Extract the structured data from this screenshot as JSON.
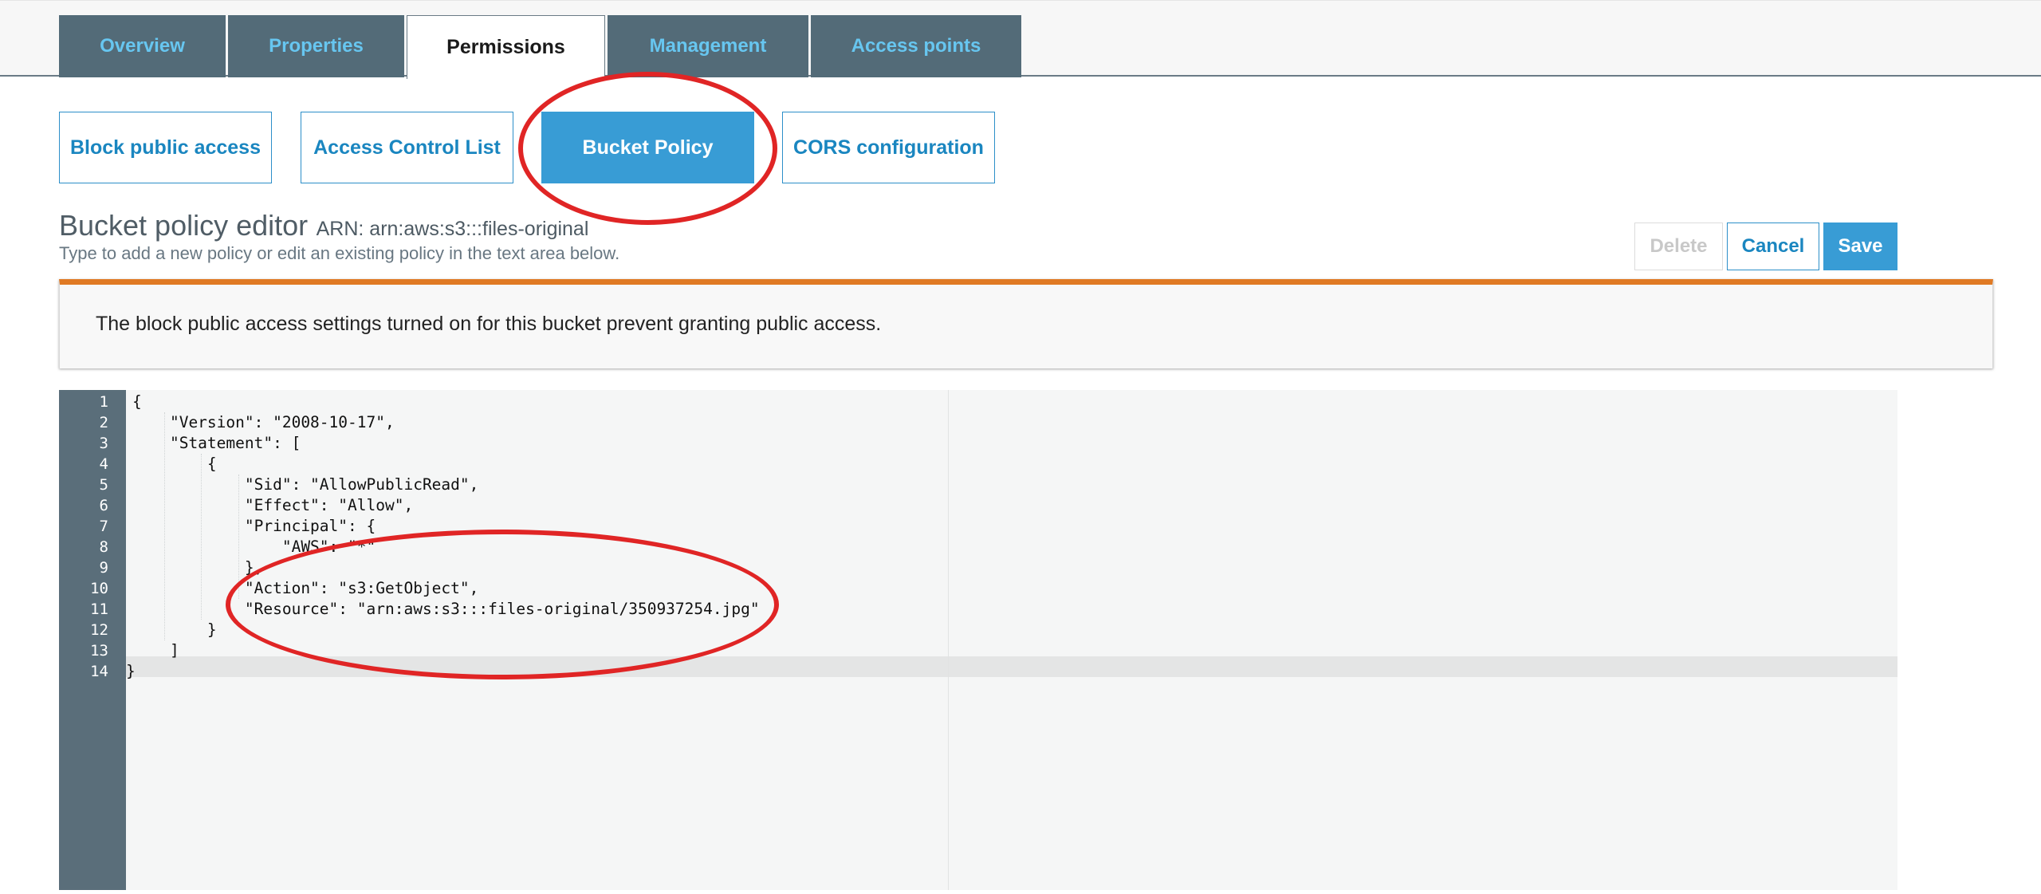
{
  "tabs": [
    {
      "label": "Overview"
    },
    {
      "label": "Properties"
    },
    {
      "label": "Permissions"
    },
    {
      "label": "Management"
    },
    {
      "label": "Access points"
    }
  ],
  "active_tab": "Permissions",
  "subtabs": [
    {
      "label": "Block public access"
    },
    {
      "label": "Access Control List"
    },
    {
      "label": "Bucket Policy"
    },
    {
      "label": "CORS configuration"
    }
  ],
  "active_subtab": "Bucket Policy",
  "editor": {
    "title": "Bucket policy editor",
    "arn": "ARN: arn:aws:s3:::files-original",
    "subtitle": "Type to add a new policy or edit an existing policy in the text area below.",
    "delete_label": "Delete",
    "cancel_label": "Cancel",
    "save_label": "Save"
  },
  "alert": {
    "text": "The block public access settings turned on for this bucket prevent granting public access.",
    "accent_color": "#e07a24"
  },
  "code": {
    "line_numbers": [
      "1",
      "2",
      "3",
      "4",
      "5",
      "6",
      "7",
      "8",
      "9",
      "10",
      "11",
      "12",
      "13",
      "14"
    ],
    "lines": [
      "{",
      "    \"Version\": \"2008-10-17\",",
      "    \"Statement\": [",
      "        {",
      "            \"Sid\": \"AllowPublicRead\",",
      "            \"Effect\": \"Allow\",",
      "            \"Principal\": {",
      "                \"AWS\": \"*\"",
      "            },",
      "            \"Action\": \"s3:GetObject\",",
      "            \"Resource\": \"arn:aws:s3:::files-original/350937254.jpg\"",
      "        }",
      "    ]",
      "}"
    ],
    "active_line": 14
  },
  "colors": {
    "tab_bg": "#536b78",
    "tab_text": "#67c6f0",
    "primary": "#389cd5",
    "annotation": "#e02525",
    "gutter": "#5a6e7a"
  }
}
